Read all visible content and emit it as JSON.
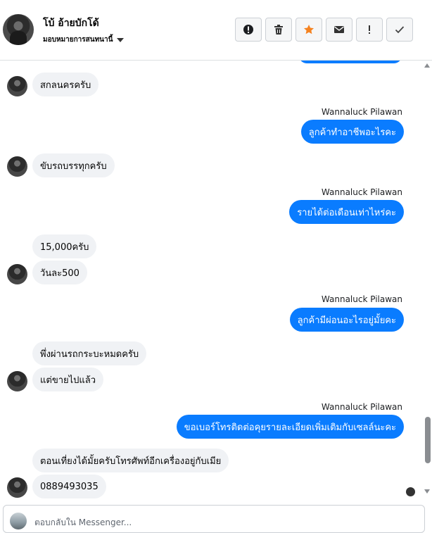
{
  "header": {
    "contact_name": "โบ้ อ้ายบักโด้",
    "assign_label": "มอบหมายการสนทนานี้"
  },
  "toolbar": [
    {
      "name": "spam-button",
      "icon": "alert-circle-icon"
    },
    {
      "name": "delete-button",
      "icon": "trash-icon"
    },
    {
      "name": "star-button",
      "icon": "star-icon"
    },
    {
      "name": "mark-unread-button",
      "icon": "mail-icon"
    },
    {
      "name": "follow-up-button",
      "icon": "exclamation-icon"
    },
    {
      "name": "done-button",
      "icon": "check-icon"
    }
  ],
  "messages": [
    {
      "id": "m1",
      "dir": "in",
      "text": "สกลนครครับ"
    },
    {
      "id": "m2",
      "dir": "out",
      "sender": "Wannaluck Pilawan",
      "text": "ลูกค้าทำอาชีพอะไรคะ"
    },
    {
      "id": "m3",
      "dir": "in",
      "text": "ขับรถบรรทุกครับ"
    },
    {
      "id": "m4",
      "dir": "out",
      "sender": "Wannaluck Pilawan",
      "text": "รายได้ต่อเดือนเท่าไหร่คะ"
    },
    {
      "id": "m5",
      "dir": "in",
      "text": "15,000ครับ"
    },
    {
      "id": "m6",
      "dir": "in",
      "text": "วันละ500"
    },
    {
      "id": "m7",
      "dir": "out",
      "sender": "Wannaluck Pilawan",
      "text": "ลูกค้ามีผ่อนอะไรอยู่มั้ยคะ"
    },
    {
      "id": "m8",
      "dir": "in",
      "text": "พึ่งผ่านรถกระบะหมดครับ"
    },
    {
      "id": "m9",
      "dir": "in",
      "text": "แต่ขายไปแล้ว"
    },
    {
      "id": "m10",
      "dir": "out",
      "sender": "Wannaluck Pilawan",
      "text": "ขอเบอร์โทรติดต่อคุยรายละเอียดเพิ่มเติมกับเซลล์นะคะ"
    },
    {
      "id": "m11",
      "dir": "in",
      "text": "ตอนเที่ยงได้มั้ยครับโทรศัพท์อีกเครื่องอยู่กับเมีย"
    },
    {
      "id": "m12",
      "dir": "in",
      "text": "0889493035"
    }
  ],
  "reply": {
    "placeholder": "ตอบกลับใน Messenger..."
  },
  "colors": {
    "outgoing_bubble": "#0a7cff",
    "incoming_bubble": "#f0f2f5",
    "star": "#f5821f"
  }
}
